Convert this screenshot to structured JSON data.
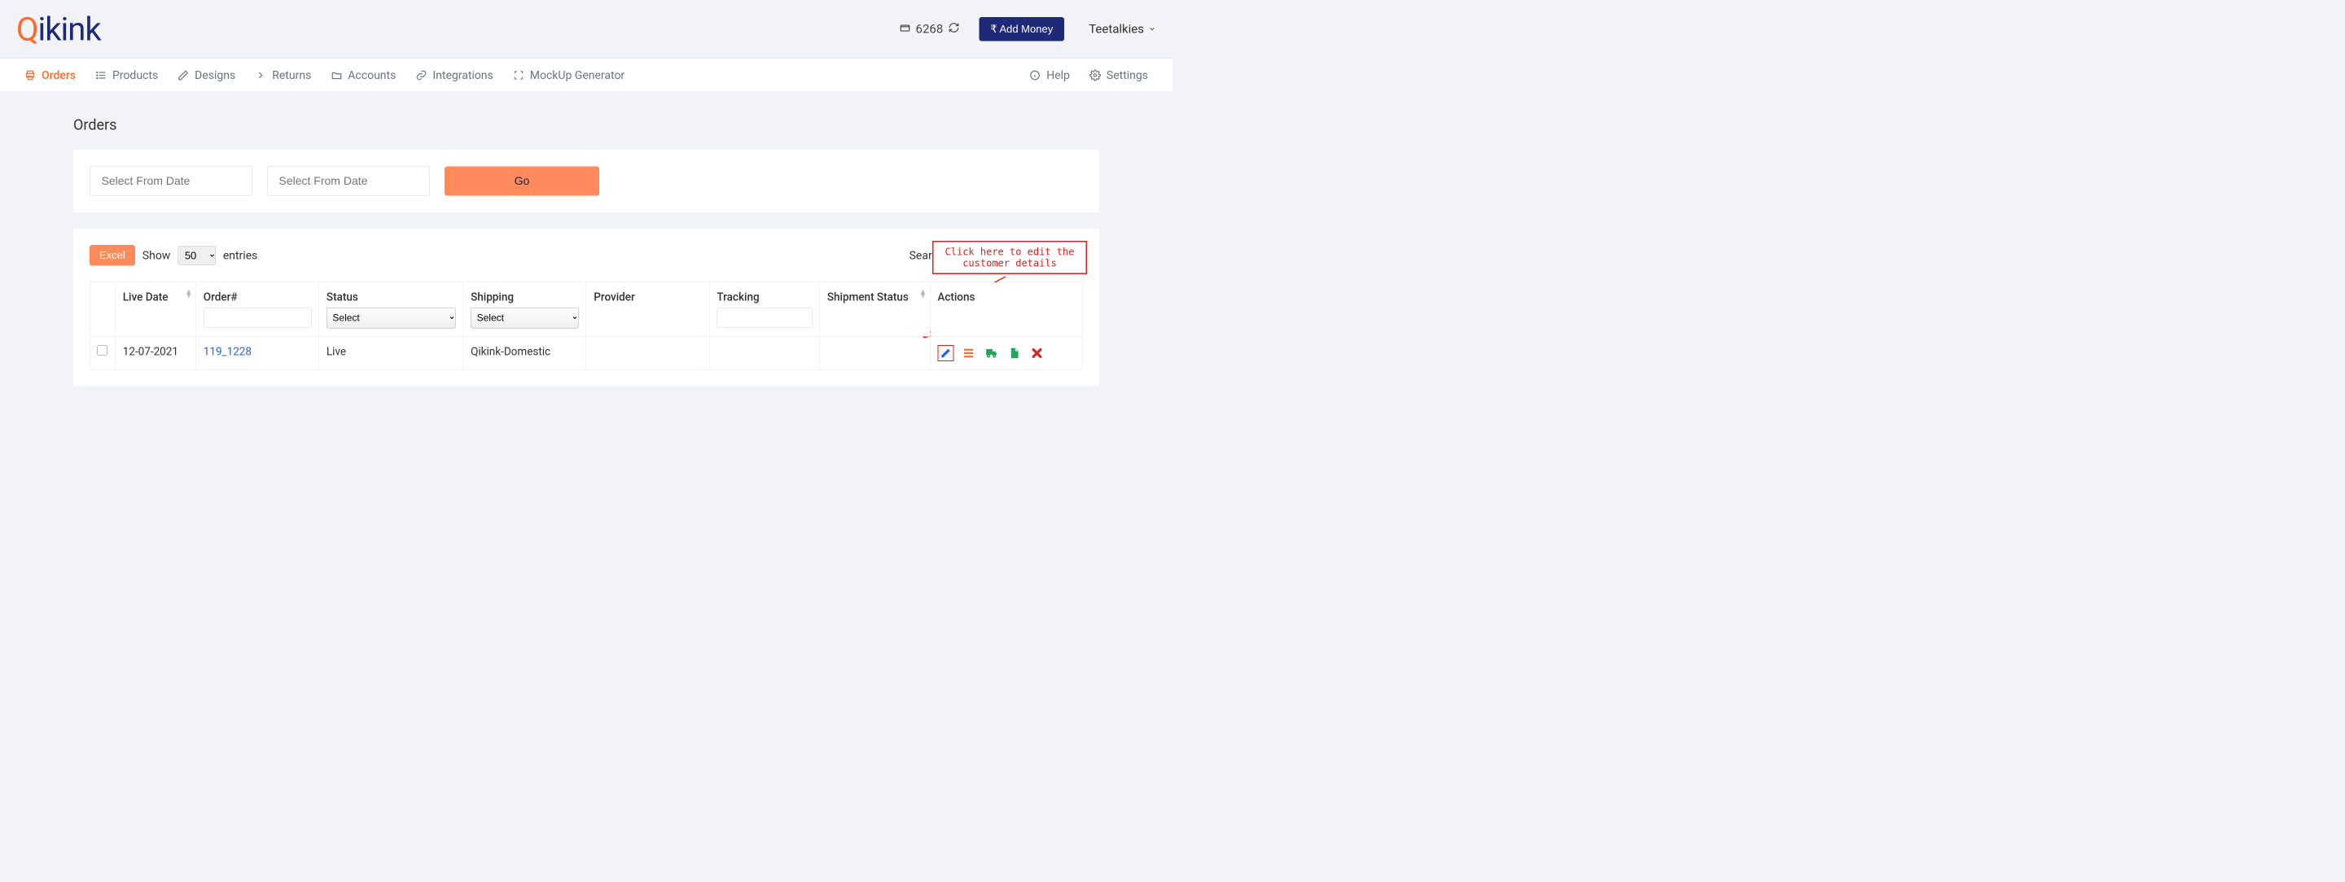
{
  "brand": {
    "q": "Q",
    "rest": "ikink"
  },
  "wallet": {
    "amount": "6268"
  },
  "buttons": {
    "add_money": "Add Money",
    "go": "Go",
    "excel": "Excel"
  },
  "user": {
    "name": "Teetalkies"
  },
  "nav": {
    "orders": "Orders",
    "products": "Products",
    "designs": "Designs",
    "returns": "Returns",
    "accounts": "Accounts",
    "integrations": "Integrations",
    "mockup": "MockUp Generator",
    "help": "Help",
    "settings": "Settings"
  },
  "page": {
    "title": "Orders"
  },
  "filters": {
    "from_date_placeholder": "Select From Date",
    "to_date_placeholder": "Select From Date"
  },
  "table": {
    "show_label": "Show",
    "entries_label": "entries",
    "entries_value": "50",
    "search_label": "Search:",
    "columns": {
      "live_date": "Live Date",
      "order": "Order#",
      "status": "Status",
      "shipping": "Shipping",
      "provider": "Provider",
      "tracking": "Tracking",
      "shipment_status": "Shipment Status",
      "actions": "Actions"
    },
    "selects": {
      "status_placeholder": "Select",
      "shipping_placeholder": "Select"
    },
    "rows": [
      {
        "live_date": "12-07-2021",
        "order_no": "119_1228",
        "status": "Live",
        "shipping": "Qikink-Domestic",
        "provider": "",
        "tracking": "",
        "shipment_status": ""
      }
    ]
  },
  "callout": {
    "line1": "Click here to edit the",
    "line2": "customer details"
  }
}
